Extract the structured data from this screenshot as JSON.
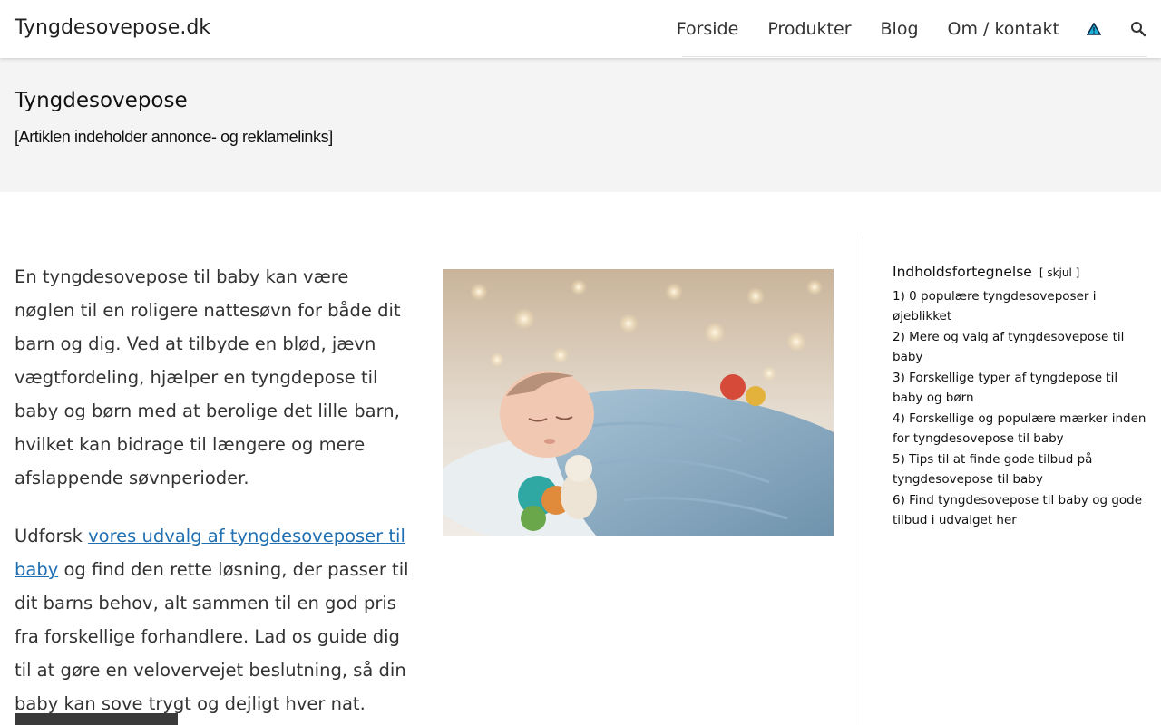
{
  "header": {
    "brand": "Tyngdesovepose.dk",
    "nav": [
      "Forside",
      "Produkter",
      "Blog",
      "Om / kontakt"
    ],
    "icons": [
      "warning-triangle-icon",
      "search-icon"
    ]
  },
  "title_band": {
    "title": "Tyngdesovepose",
    "disclaimer": "[Artiklen indeholder annonce- og reklamelinks]"
  },
  "article": {
    "para1": "En tyngdesovepose til baby kan være nøglen til en roligere nattesøvn for både dit barn og dig. Ved at tilbyde en blød, jævn vægtfordeling, hjælper en tyngdepose til baby og børn med at berolige det lille barn, hvilket kan bidrage til længere og mere afslappende søvnperioder.",
    "para2_prefix": "Udforsk ",
    "para2_link": "vores udvalg af tyngdesoveposer til baby",
    "para2_suffix": " og find den rette løsning, der passer til dit barns behov, alt sammen til en god pris fra forskellige forhandlere. Lad os guide dig til at gøre en velovervejet beslutning, så din baby kan sove trygt og dejligt hver nat.",
    "image_subject": "sleeping-baby-photo"
  },
  "toc": {
    "title": "Indholdsfortegnelse",
    "toggle_open": "[",
    "toggle_label": "skjul",
    "toggle_close": "]",
    "items": [
      "1) 0 populære tyngdesoveposer i øjeblikket",
      "2) Mere og valg af tyngdesovepose til baby",
      "3) Forskellige typer af tyngdepose til baby og børn",
      "4) Forskellige og populære mærker inden for tyngdesovepose til baby",
      "5) Tips til at finde gode tilbud på tyngdesovepose til baby",
      "6) Find tyngdesovepose til baby og gode tilbud i udvalget her"
    ]
  },
  "colors": {
    "link": "#1f6fb2",
    "title_band_bg": "#f4f4f4",
    "warning_icon_fill": "#1ab0d8"
  }
}
